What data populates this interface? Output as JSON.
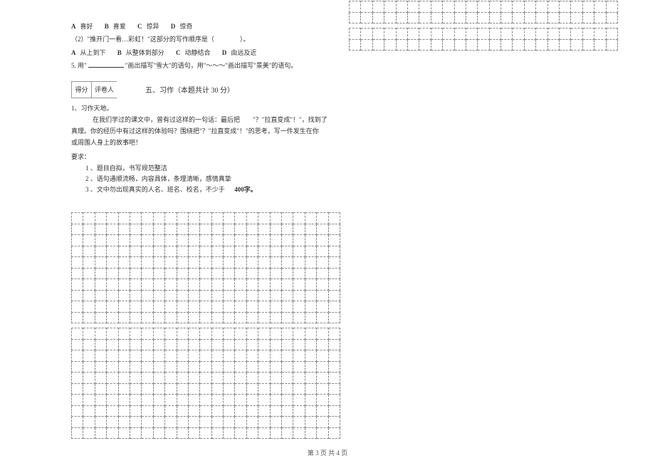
{
  "q_options_1": {
    "A": "喜好",
    "B": "喜爱",
    "C": "惊异",
    "D": "惊奇"
  },
  "q2_text": "（2）\"推开门一看…彩虹！\"这部分的写作顺序是（　　　　）。",
  "q_options_2": {
    "A": "从上到下",
    "B": "从整体到部分",
    "C": "动静结合",
    "D": "由远及近"
  },
  "q5_prefix": "5. 用\"",
  "q5_mid": "\"画出描写\"雪大\"的语句，用\"",
  "q5_wavy": "～～～",
  "q5_suffix": "\"画出描写\"景美\"的语句。",
  "score_labels": {
    "score": "得分",
    "grader": "评卷人"
  },
  "section_title": "五、习作（本题共计    30 分）",
  "essay": {
    "heading": "1、习作天地。",
    "line1_a": "在我们学过的课文中，曾有过这样的一句话：最后把",
    "line1_b": "\"？\"拉直变成\"！\"，找到了",
    "line2": "真理。你的经历中有过这样的体验吗？围绕把\"？\"拉直变成\"！\"的思考，写一件发生在你",
    "line3": "或周围人身上的故事吧！",
    "req_heading": "要求：",
    "req1": "1 、题目自拟，书写规范整洁",
    "req2": "2 、语句通顺流畅，内容具体，条理清晰，感情真挚",
    "req3_a": "3 、文中勿出现真实的人名、班名、校名，不少于",
    "req3_b": "400字。"
  },
  "footer": "第 3 页 共 4 页"
}
